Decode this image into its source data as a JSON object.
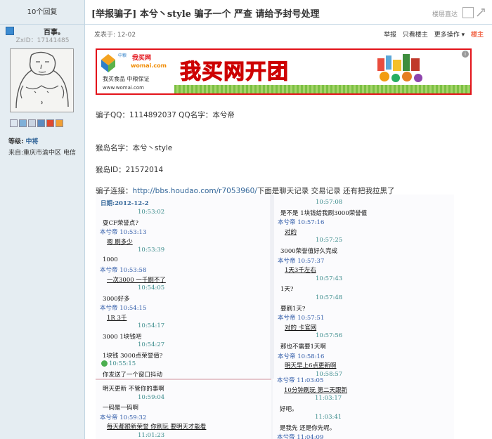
{
  "left": {
    "replies_label": "10个回复",
    "username": "百事。",
    "zxid": "ZxID：17141485",
    "level_label": "等级:",
    "level_value": "中将",
    "from": "来自:重庆市渝中区 电信"
  },
  "thread": {
    "title": "[举报骗子] 本兮丶style  骗子一个 严查 请给予封号处理",
    "floor_jump": "楼层直达",
    "posted": "发表于: 12-02",
    "actions": [
      "举报",
      "只看楼主",
      "更多操作 ▾"
    ],
    "floor": "楼主"
  },
  "ad": {
    "brand_top": "中粮",
    "brand_name": "我买网",
    "brand_domain": "womai.com",
    "brand_line2": "我买食品  中粮保证",
    "brand_url": "www.womai.com",
    "headline": "我买网开团",
    "info": "i"
  },
  "post": {
    "line1": "骗子QQ：1114892037 QQ名字：本兮帝",
    "line2": "猴岛名字：本兮丶style",
    "line3": "猴岛ID：21572014",
    "line4_prefix": "骗子连接：",
    "link": "http://bbs.houdao.com/r7053960/",
    "line4_suffix": "下面是聊天记录 交易记录  还有把我拉黑了"
  },
  "chat": {
    "date": "日期:2012-12-2",
    "left": [
      {
        "t": "10:53:02"
      },
      {
        "m": "耍CF荣誉点?"
      },
      {
        "w": "本兮帝  10:53:13"
      },
      {
        "m": "嗯 刷多少",
        "u": true
      },
      {
        "t": "10:53:39"
      },
      {
        "m": "1000"
      },
      {
        "w": "本兮帝  10:53:58"
      },
      {
        "m": "一次3000  一千刷不了",
        "u": true
      },
      {
        "t": "10:54:05"
      },
      {
        "m": "3000好多"
      },
      {
        "w": "本兮帝  10:54:15"
      },
      {
        "m": "1R 3千",
        "u": true
      },
      {
        "t": "10:54:17"
      },
      {
        "m": "3000  1块钱吧"
      },
      {
        "t": "10:54:27"
      },
      {
        "m": "1块钱  3000点荣誉值?"
      },
      {
        "c": "10:55:15"
      },
      {
        "m": "你发送了一个窗口抖动"
      }
    ],
    "right": [
      {
        "t": "10:57:08"
      },
      {
        "m": "是不是 1块钱给我刷3000荣誉值"
      },
      {
        "w": "本兮帝  10:57:16"
      },
      {
        "m": "对的",
        "u": true
      },
      {
        "t": "10:57:25"
      },
      {
        "m": "3000荣誉值好久完成"
      },
      {
        "w": "本兮帝  10:57:37"
      },
      {
        "m": "1天3千左右",
        "u": true
      },
      {
        "t": "10:57:43"
      },
      {
        "m": "1天?"
      },
      {
        "t": "10:57:48"
      },
      {
        "m": "要刷1天?"
      },
      {
        "w": "本兮帝  10:57:51"
      },
      {
        "m": "对的  卡官网",
        "u": true
      },
      {
        "t": "10:57:56"
      },
      {
        "m": "那也不需要1天啊"
      },
      {
        "w": "本兮帝  10:58:16"
      },
      {
        "m": "明天早上6点更新啊",
        "u": true
      },
      {
        "t": "10:58:57"
      }
    ],
    "left2": [
      {
        "m": "明天更新  不管你的事啊"
      },
      {
        "t": "10:59:04"
      },
      {
        "m": "一码是一码啊"
      },
      {
        "w": "本兮帝  10:59:32"
      },
      {
        "m": "每天都跟新荣誉 你刷玩 要明天才能看",
        "u": true
      },
      {
        "t": "11:01:23"
      }
    ],
    "right2": [
      {
        "w": "本兮帝  11:03:05"
      },
      {
        "m": "10分钟刷玩 第二天跟新",
        "u": true
      },
      {
        "t": "11:03:17"
      },
      {
        "m": "好吧。"
      },
      {
        "t": "11:03:41"
      },
      {
        "m": "是我先  还是你先呢。"
      },
      {
        "w": "本兮帝  11:04:09"
      }
    ]
  },
  "colors": {
    "sidebar_bg": "#e5edf2",
    "border": "#c2d5e3",
    "link": "#336699",
    "floor": "#f26c4f",
    "ad_red": "#e3131a"
  }
}
